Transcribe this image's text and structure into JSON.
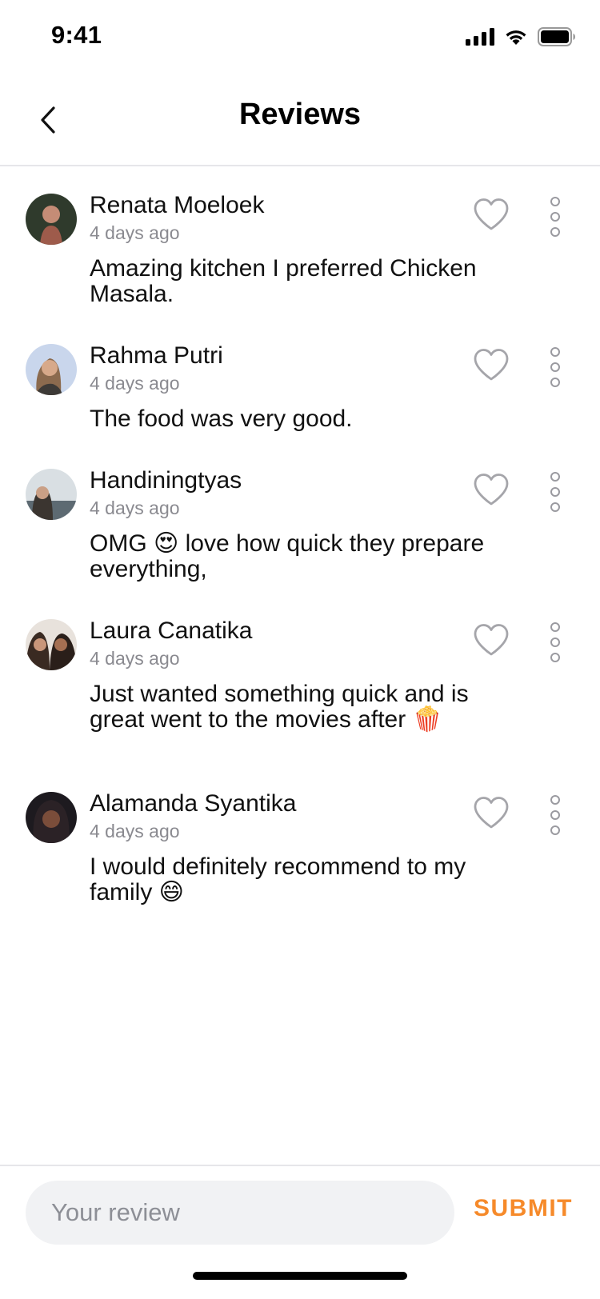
{
  "status_bar": {
    "time": "9:41"
  },
  "header": {
    "title": "Reviews",
    "back_icon": "chevron-left-icon"
  },
  "reviews": [
    {
      "name": "Renata Moeloek",
      "time": "4 days ago",
      "text": "Amazing kitchen I preferred Chicken Masala.",
      "avatar_colors": [
        "#2f3a2c",
        "#9e5b4b"
      ]
    },
    {
      "name": "Rahma Putri",
      "time": "4 days ago",
      "text": "The food was very good.",
      "avatar_colors": [
        "#c9d6ec",
        "#8b6a4e"
      ]
    },
    {
      "name": "Handiningtyas",
      "time": "4 days ago",
      "text": "OMG 😍 love how quick they prepare everything,",
      "avatar_colors": [
        "#d9dfe3",
        "#3b3530"
      ]
    },
    {
      "name": "Laura Canatika",
      "time": "4 days ago",
      "text": "Just wanted something quick and is great went to the movies after 🍿",
      "avatar_colors": [
        "#e8e2dc",
        "#3a2a22"
      ]
    },
    {
      "name": "Alamanda Syantika",
      "time": "4 days ago",
      "text": "I would definitely recommend to my family 😄",
      "avatar_colors": [
        "#1d1a1f",
        "#7a4d3a"
      ]
    }
  ],
  "composer": {
    "placeholder": "Your review",
    "submit_label": "SUBMIT"
  },
  "colors": {
    "accent": "#f68a2a",
    "divider": "#e6e6ea",
    "secondary_text": "#8a8a90",
    "input_bg": "#f1f2f4"
  }
}
